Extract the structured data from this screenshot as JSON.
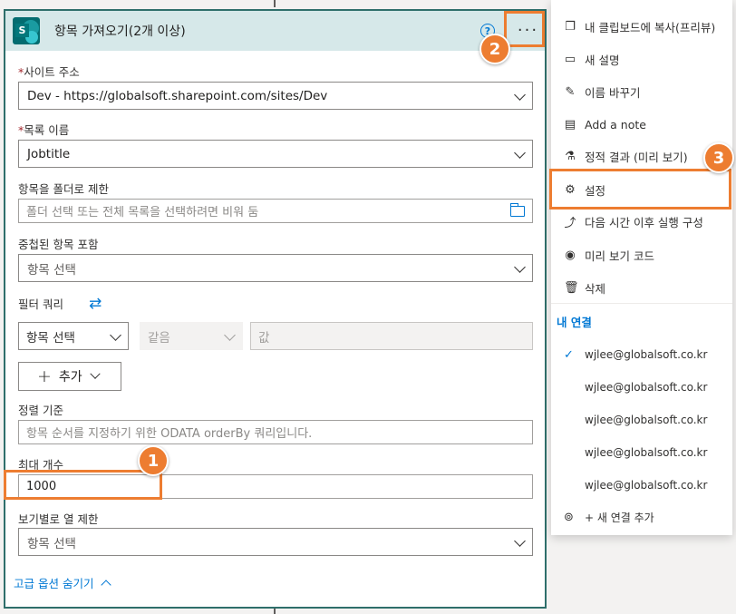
{
  "card": {
    "title": "항목 가져오기(2개 이상)",
    "help_glyph": "?",
    "more_glyph": "···",
    "fields": {
      "site_address": {
        "label": "사이트 주소",
        "value": "Dev - https://globalsoft.sharepoint.com/sites/Dev",
        "required": true
      },
      "list_name": {
        "label": "목록 이름",
        "value": "Jobtitle",
        "required": true
      },
      "folder_limit": {
        "label": "항목을 폴더로 제한",
        "placeholder": "폴더 선택 또는 전체 목록을 선택하려면 비워 둠"
      },
      "nested_items": {
        "label": "중첩된 항목 포함",
        "value": "항목 선택"
      },
      "filter_query": {
        "label": "필터 쿼리",
        "field": "항목 선택",
        "operator": "같음",
        "value": "값"
      },
      "add_button": {
        "label": "추가"
      },
      "order_by": {
        "label": "정렬 기준",
        "placeholder": "항목 순서를 지정하기 위한 ODATA orderBy 쿼리입니다."
      },
      "top_count": {
        "label": "최대 개수",
        "value": "1000"
      },
      "limit_columns": {
        "label": "보기별로 열 제한",
        "value": "항목 선택"
      }
    },
    "advanced_toggle": "고급 옵션 숨기기"
  },
  "required_mark": "*",
  "badges": {
    "one": "1",
    "two": "2",
    "three": "3"
  },
  "menu": {
    "items": [
      {
        "label": "내 클립보드에 복사(프리뷰)",
        "icon": "copy-icon"
      },
      {
        "label": "새 설명",
        "icon": "comment-icon"
      },
      {
        "label": "이름 바꾸기",
        "icon": "pencil-icon"
      },
      {
        "label": "Add a note",
        "icon": "note-icon"
      },
      {
        "label": "정적 결과 (미리 보기)",
        "icon": "flask-icon"
      },
      {
        "label": "설정",
        "icon": "gear-icon"
      },
      {
        "label": "다음 시간 이후 실행 구성",
        "icon": "run-after-icon"
      },
      {
        "label": "미리 보기 코드",
        "icon": "eye-icon"
      },
      {
        "label": "삭제",
        "icon": "trash-icon"
      }
    ],
    "connections_title": "내 연결",
    "connections": [
      {
        "email": "wjlee@globalsoft.co.kr",
        "active": true
      },
      {
        "email": "wjlee@globalsoft.co.kr",
        "active": false
      },
      {
        "email": "wjlee@globalsoft.co.kr",
        "active": false
      },
      {
        "email": "wjlee@globalsoft.co.kr",
        "active": false
      },
      {
        "email": "wjlee@globalsoft.co.kr",
        "active": false
      }
    ],
    "add_connection": "+ 새 연결 추가"
  },
  "colors": {
    "accent": "#0078d4",
    "highlight": "#ed7d31",
    "header_bg": "#d6e8e9",
    "card_border": "#2f6f6b"
  }
}
